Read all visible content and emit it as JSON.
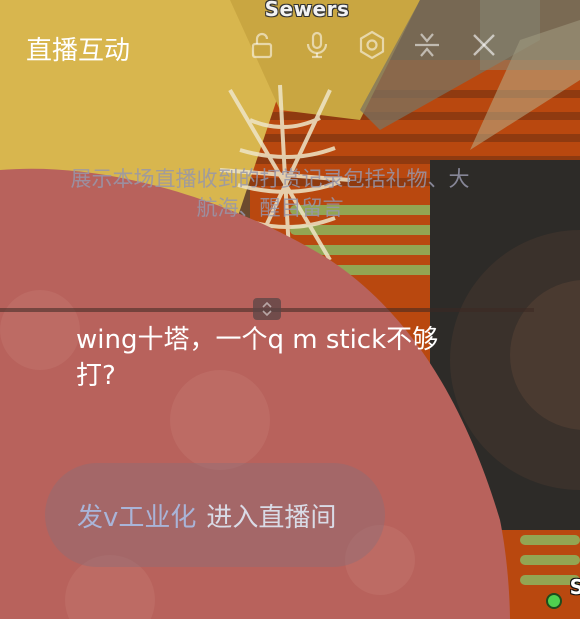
{
  "game": {
    "title": "Sewers",
    "corner_badge": "S"
  },
  "panel": {
    "title": "直播互动",
    "empty_hint": "展示本场直播收到的打赏记录包括礼物、大航海、醒目留言",
    "icons": [
      "unlock-icon",
      "microphone-icon",
      "settings-icon",
      "collapse-icon",
      "close-icon"
    ]
  },
  "chat": {
    "message": "wing十塔，一个q m stick不够打?"
  },
  "entry": {
    "username": "发v工业化",
    "action": "进入直播间"
  },
  "colors": {
    "blob_red": "#b8625c",
    "yellow": "#d8b64e",
    "orange_stripes": "#c84f12",
    "green_stripes": "#8fb05a",
    "username_blue": "#a9b4d8"
  }
}
